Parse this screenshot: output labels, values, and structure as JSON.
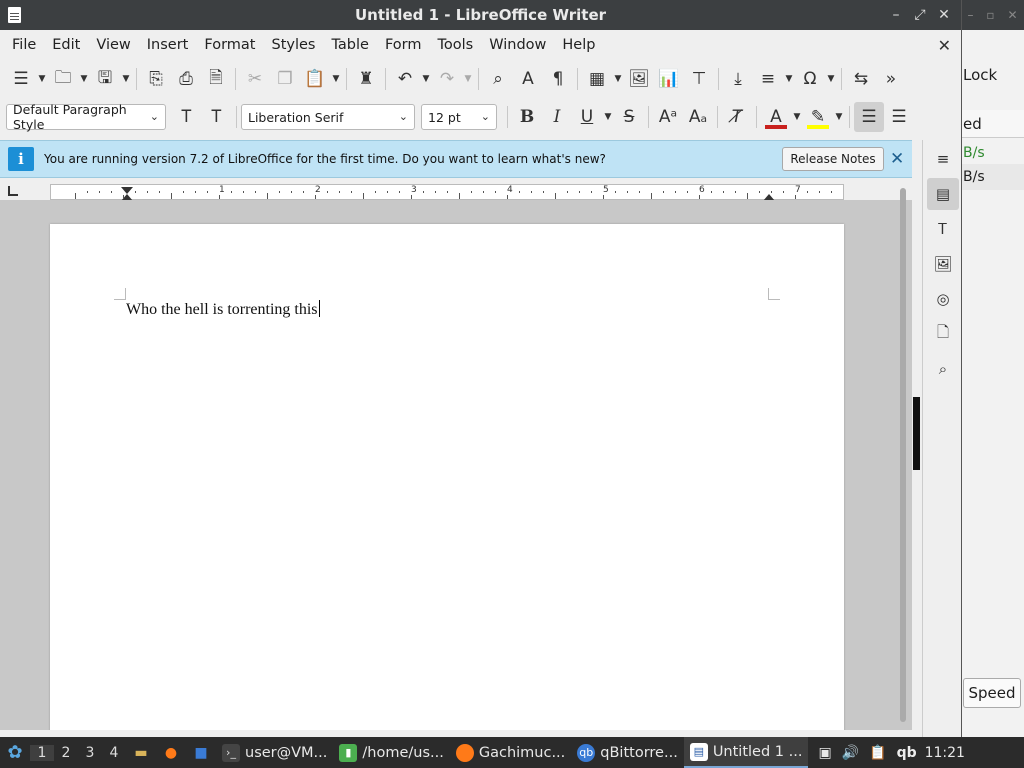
{
  "window": {
    "title": "Untitled 1 - LibreOffice Writer",
    "controls": [
      "minimize",
      "restore",
      "close"
    ]
  },
  "menubar": {
    "items": [
      "File",
      "Edit",
      "View",
      "Insert",
      "Format",
      "Styles",
      "Table",
      "Form",
      "Tools",
      "Window",
      "Help"
    ],
    "close_symbol": "✕"
  },
  "formatting": {
    "paragraph_style": "Default Paragraph Style",
    "font_name": "Liberation Serif",
    "font_size": "12 pt"
  },
  "infobar": {
    "message": "You are running version 7.2 of LibreOffice for the first time. Do you want to learn what's new?",
    "button_label": "Release Notes",
    "close_symbol": "✕",
    "icon_glyph": "i"
  },
  "ruler": {
    "numbers": [
      "1",
      "2",
      "3",
      "4",
      "5",
      "6",
      "7"
    ]
  },
  "document": {
    "text": "Who the hell is torrenting this"
  },
  "background_window": {
    "toolbar_label": "Lock",
    "column_header": "ed",
    "row1": "B/s",
    "row2": "B/s",
    "speed_button": "Speed"
  },
  "taskbar": {
    "workspaces": [
      "1",
      "2",
      "3",
      "4"
    ],
    "tasks": [
      {
        "label": "user@VM...",
        "icon": "terminal-icon"
      },
      {
        "label": "/home/us...",
        "icon": "folder-icon"
      },
      {
        "label": "Gachimuc...",
        "icon": "firefox-icon"
      },
      {
        "label": "qBittorre...",
        "icon": "qbittorrent-icon"
      },
      {
        "label": "Untitled 1 ...",
        "icon": "writer-icon"
      }
    ],
    "tray_qb": "qb",
    "clock": "11:21"
  },
  "colors": {
    "titlebar": "#3c3f41",
    "infobar": "#bfe3f5",
    "font_color_bar": "#c9211e",
    "highlight_bar": "#ffff00",
    "taskbar": "#2b2b2b"
  }
}
